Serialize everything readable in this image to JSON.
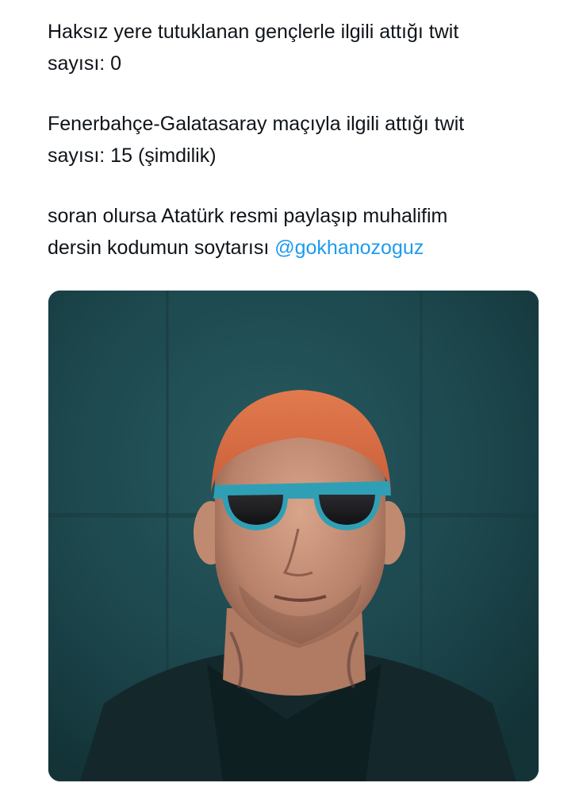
{
  "tweet": {
    "paragraphs": [
      {
        "lines": [
          "Haksız yere tutuklanan gençlerle ilgili attığı twit",
          "sayısı: 0"
        ]
      },
      {
        "lines": [
          "Fenerbahçe-Galatasaray maçıyla ilgili attığı twit",
          "sayısı: 15 (şimdilik)"
        ]
      },
      {
        "lines": [
          "soran olursa Atatürk resmi paylaşıp muhalifim",
          "dersin kodumun soytarısı "
        ],
        "mention": "@gokhanozoguz"
      }
    ]
  },
  "colors": {
    "text": "#0f1419",
    "mention": "#1d9bf0",
    "photo_background": "#214f55"
  },
  "media": {
    "type": "photo",
    "icon": "photo-of-man-with-sunglasses"
  }
}
